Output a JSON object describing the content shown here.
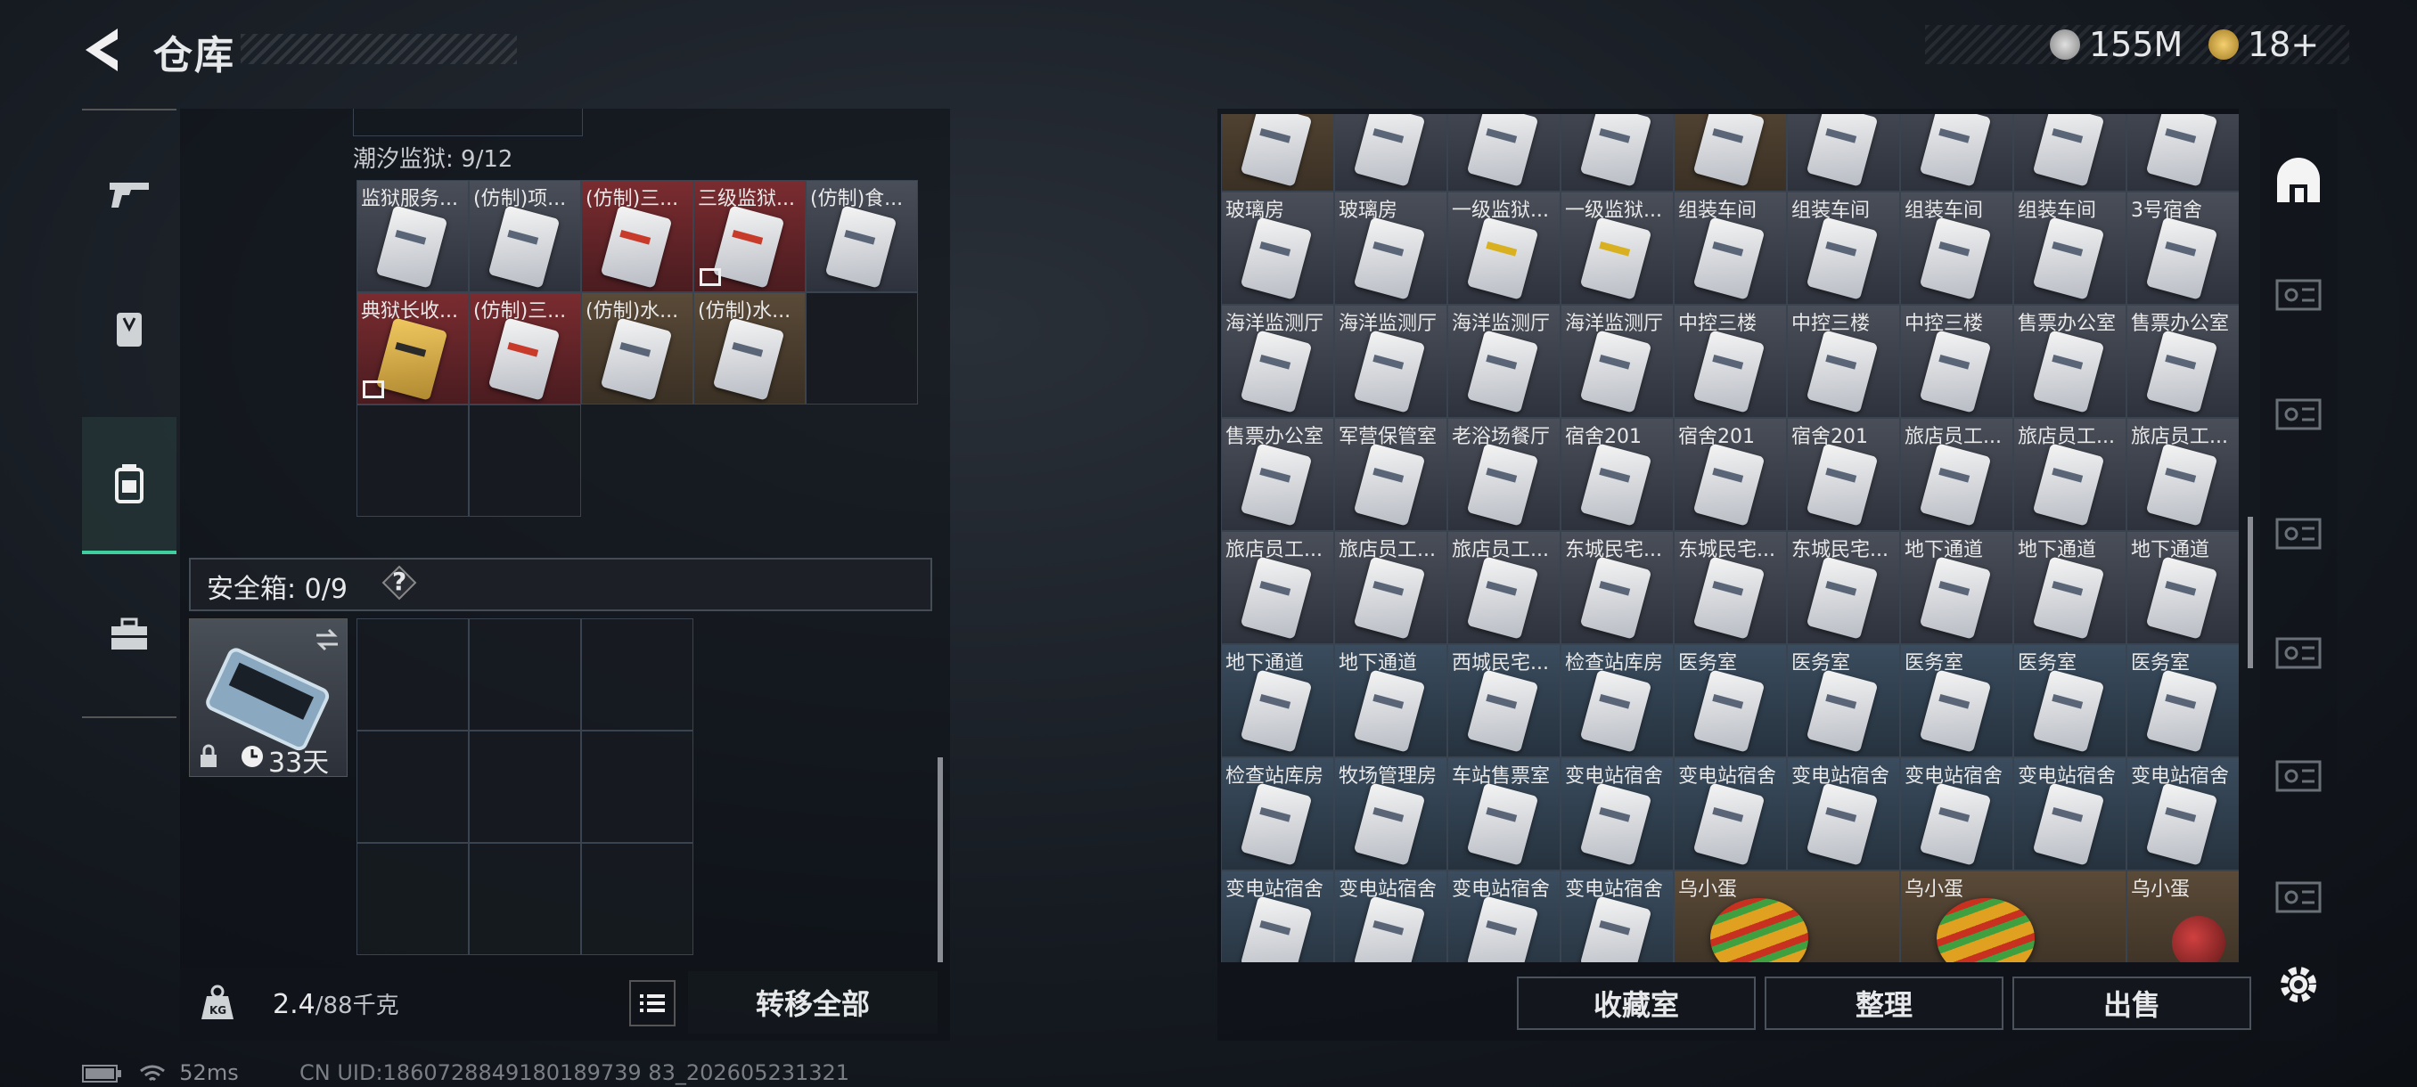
{
  "header": {
    "title": "仓库",
    "currency_1": "155M",
    "currency_2": "18+"
  },
  "left_nav": [
    "weapon-tab-icon",
    "armor-tab-icon",
    "backpack-tab-icon",
    "briefcase-tab-icon"
  ],
  "container": {
    "title": "潮汐监狱: 9/12",
    "items": [
      {
        "label": "监狱服务...",
        "bg": "grey",
        "card": "white"
      },
      {
        "label": "(仿制)项...",
        "bg": "grey",
        "card": "white"
      },
      {
        "label": "(仿制)三...",
        "bg": "red",
        "card": "red"
      },
      {
        "label": "三级监狱...",
        "bg": "red",
        "card": "red",
        "flag": true
      },
      {
        "label": "(仿制)食...",
        "bg": "grey",
        "card": "white"
      },
      {
        "label": "典狱长收...",
        "bg": "red",
        "card": "gold",
        "flag": true
      },
      {
        "label": "(仿制)三...",
        "bg": "red",
        "card": "red"
      },
      {
        "label": "(仿制)水...",
        "bg": "brown",
        "card": "white"
      },
      {
        "label": "(仿制)水...",
        "bg": "brown",
        "card": "white"
      }
    ]
  },
  "safe_box": {
    "label": "安全箱: 0/9",
    "help": "?",
    "duration": "33天"
  },
  "footer_left": {
    "weight_current": "2.4",
    "weight_max": "/88千克",
    "transfer_label": "转移全部"
  },
  "stash": {
    "rows": [
      [
        {
          "label": "",
          "bg": "brown"
        },
        {
          "label": "",
          "bg": "grey"
        },
        {
          "label": "",
          "bg": "grey"
        },
        {
          "label": "",
          "bg": "grey"
        },
        {
          "label": "",
          "bg": "brown"
        },
        {
          "label": "",
          "bg": "grey"
        },
        {
          "label": "",
          "bg": "grey"
        },
        {
          "label": "",
          "bg": "grey"
        },
        {
          "label": "",
          "bg": "grey"
        }
      ],
      [
        {
          "label": "玻璃房",
          "bg": "grey"
        },
        {
          "label": "玻璃房",
          "bg": "grey"
        },
        {
          "label": "一级监狱...",
          "bg": "grey",
          "card": "yellow"
        },
        {
          "label": "一级监狱...",
          "bg": "grey",
          "card": "yellow"
        },
        {
          "label": "组装车间",
          "bg": "grey"
        },
        {
          "label": "组装车间",
          "bg": "grey"
        },
        {
          "label": "组装车间",
          "bg": "grey"
        },
        {
          "label": "组装车间",
          "bg": "grey"
        },
        {
          "label": "3号宿舍",
          "bg": "grey"
        }
      ],
      [
        {
          "label": "海洋监测厅",
          "bg": "grey"
        },
        {
          "label": "海洋监测厅",
          "bg": "grey"
        },
        {
          "label": "海洋监测厅",
          "bg": "grey"
        },
        {
          "label": "海洋监测厅",
          "bg": "grey"
        },
        {
          "label": "中控三楼",
          "bg": "grey"
        },
        {
          "label": "中控三楼",
          "bg": "grey"
        },
        {
          "label": "中控三楼",
          "bg": "grey"
        },
        {
          "label": "售票办公室",
          "bg": "grey"
        },
        {
          "label": "售票办公室",
          "bg": "grey"
        }
      ],
      [
        {
          "label": "售票办公室",
          "bg": "grey"
        },
        {
          "label": "军营保管室",
          "bg": "grey"
        },
        {
          "label": "老浴场餐厅",
          "bg": "grey"
        },
        {
          "label": "宿舍201",
          "bg": "grey"
        },
        {
          "label": "宿舍201",
          "bg": "grey"
        },
        {
          "label": "宿舍201",
          "bg": "grey"
        },
        {
          "label": "旅店员工...",
          "bg": "grey"
        },
        {
          "label": "旅店员工...",
          "bg": "grey"
        },
        {
          "label": "旅店员工...",
          "bg": "grey"
        }
      ],
      [
        {
          "label": "旅店员工...",
          "bg": "grey"
        },
        {
          "label": "旅店员工...",
          "bg": "grey"
        },
        {
          "label": "旅店员工...",
          "bg": "grey"
        },
        {
          "label": "东城民宅...",
          "bg": "grey"
        },
        {
          "label": "东城民宅...",
          "bg": "grey"
        },
        {
          "label": "东城民宅...",
          "bg": "grey"
        },
        {
          "label": "地下通道",
          "bg": "grey"
        },
        {
          "label": "地下通道",
          "bg": "grey"
        },
        {
          "label": "地下通道",
          "bg": "grey"
        }
      ],
      [
        {
          "label": "地下通道",
          "bg": "blue"
        },
        {
          "label": "地下通道",
          "bg": "blue"
        },
        {
          "label": "西城民宅...",
          "bg": "blue"
        },
        {
          "label": "检查站库房",
          "bg": "blue"
        },
        {
          "label": "医务室",
          "bg": "blue"
        },
        {
          "label": "医务室",
          "bg": "blue"
        },
        {
          "label": "医务室",
          "bg": "blue"
        },
        {
          "label": "医务室",
          "bg": "blue"
        },
        {
          "label": "医务室",
          "bg": "blue"
        }
      ],
      [
        {
          "label": "检查站库房",
          "bg": "blue"
        },
        {
          "label": "牧场管理房",
          "bg": "blue"
        },
        {
          "label": "车站售票室",
          "bg": "blue"
        },
        {
          "label": "变电站宿舍",
          "bg": "blue"
        },
        {
          "label": "变电站宿舍",
          "bg": "blue"
        },
        {
          "label": "变电站宿舍",
          "bg": "blue"
        },
        {
          "label": "变电站宿舍",
          "bg": "blue"
        },
        {
          "label": "变电站宿舍",
          "bg": "blue"
        },
        {
          "label": "变电站宿舍",
          "bg": "blue"
        }
      ],
      [
        {
          "label": "变电站宿舍",
          "bg": "blue"
        },
        {
          "label": "变电站宿舍",
          "bg": "blue"
        },
        {
          "label": "变电站宿舍",
          "bg": "blue"
        },
        {
          "label": "变电站宿舍",
          "bg": "blue"
        },
        {
          "label": "乌小蛋",
          "bg": "brown",
          "card": "egg",
          "span": 2
        },
        {
          "label": "乌小蛋",
          "bg": "brown",
          "card": "egg",
          "span": 2
        },
        {
          "label": "乌小蛋",
          "bg": "brown",
          "card": "bird"
        }
      ]
    ]
  },
  "footer_right": {
    "collection_label": "收藏室",
    "sort_label": "整理",
    "sell_label": "出售"
  },
  "right_nav": [
    "home-base-icon",
    "vehicle-slot-icon",
    "vehicle-slot-icon",
    "vehicle-slot-icon",
    "vehicle-slot-icon",
    "gti-slot-icon",
    "gti-slot-icon",
    "settings-gear-icon"
  ],
  "status": {
    "ping": "52ms",
    "uid": "CN UID:1860728849180189739 83_202605231321"
  }
}
